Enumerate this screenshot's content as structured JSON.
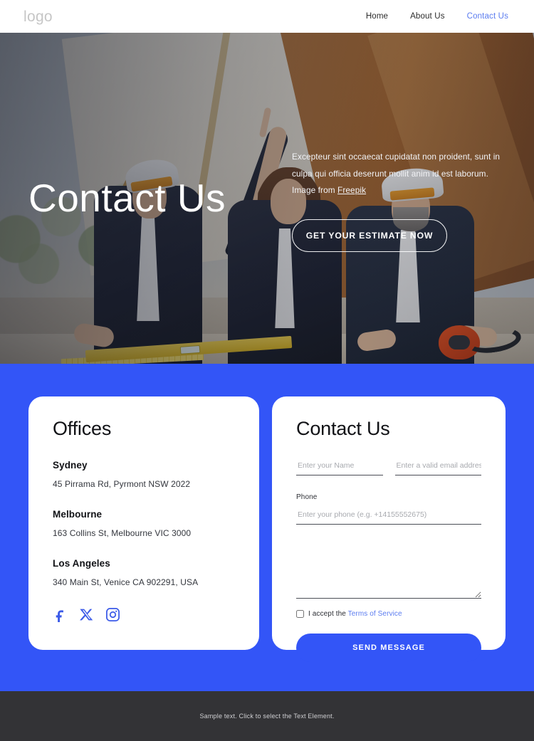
{
  "header": {
    "logo": "logo",
    "nav": [
      {
        "label": "Home",
        "active": false
      },
      {
        "label": "About Us",
        "active": false
      },
      {
        "label": "Contact Us",
        "active": true
      }
    ]
  },
  "hero": {
    "title": "Contact Us",
    "paragraph": "Excepteur sint occaecat cupidatat non proident, sunt in culpa qui officia deserunt mollit anim id est laborum.",
    "credit_prefix": "Image from ",
    "credit_link": "Freepik",
    "cta_label": "GET YOUR ESTIMATE NOW"
  },
  "offices": {
    "title": "Offices",
    "locations": [
      {
        "city": "Sydney",
        "address": "45 Pirrama Rd, Pyrmont NSW 2022"
      },
      {
        "city": "Melbourne",
        "address": "163 Collins St, Melbourne VIC 3000"
      },
      {
        "city": "Los Angeles",
        "address": "340 Main St, Venice CA 902291, USA"
      }
    ],
    "socials": [
      {
        "name": "facebook-icon"
      },
      {
        "name": "x-twitter-icon"
      },
      {
        "name": "instagram-icon"
      }
    ]
  },
  "contact_form": {
    "title": "Contact Us",
    "name_placeholder": "Enter your Name",
    "email_placeholder": "Enter a valid email address",
    "phone_label": "Phone",
    "phone_placeholder": "Enter your phone (e.g. +14155552675)",
    "message_placeholder": "",
    "name_value": "",
    "email_value": "",
    "phone_value": "",
    "message_value": "",
    "accept_text": "I accept the ",
    "terms_label": "Terms of Service",
    "accept_checked": false,
    "submit_label": "SEND MESSAGE"
  },
  "footer": {
    "text": "Sample text. Click to select the Text Element."
  },
  "colors": {
    "brand_blue": "#3355f7",
    "link_blue": "#5b7cf0",
    "footer_bg": "#333336",
    "logo_gray": "#c6c6c6"
  }
}
